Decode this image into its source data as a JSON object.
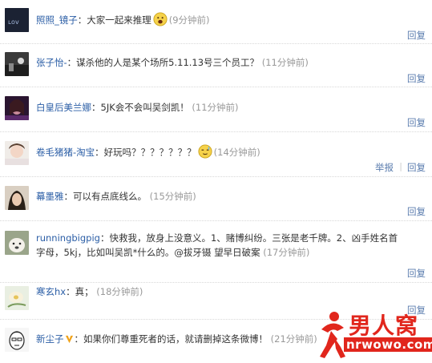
{
  "comments": [
    {
      "user": "照照_镜子",
      "text": "大家一起来推理",
      "time": "(9分钟前)",
      "reply": "回复",
      "emoji": "yawning-face-icon"
    },
    {
      "user": "张子怡-",
      "text": "谋杀他的人是某个场所5.11.13号三个员工？",
      "time": "(11分钟前)",
      "reply": "回复"
    },
    {
      "user": "白皇后美兰娜",
      "text": "5JK会不会叫吴剑凯！",
      "time": "(11分钟前)",
      "reply": "回复"
    },
    {
      "user": "卷毛猪猪-淘宝",
      "text": "好玩吗？？？？？？？",
      "time": "(14分钟前)",
      "report": "举报",
      "reply": "回复",
      "emoji": "sweating-face-icon"
    },
    {
      "user": "幕墨雅",
      "text": "可以有点底线么。",
      "time": "(15分钟前)",
      "reply": "回复"
    },
    {
      "user": "runningbigpig",
      "text": "快救我，放身上没意义。1、赌博纠纷。三张是老千牌。2、凶手姓名首字母，5kj，比如叫吴凯*什么的。@拔牙镊 望早日破案",
      "time": "(17分钟前)",
      "reply": "回复"
    },
    {
      "user": "寒玄hx",
      "text": "真；",
      "time": "(18分钟前)",
      "reply": "回复"
    },
    {
      "user": "新尘子",
      "text": "如果你们尊重死者的话，就请删掉这条微博！",
      "time": "(21分钟前)",
      "reply": "回复"
    }
  ],
  "separator": "：",
  "watermark": {
    "name": "男人窝",
    "url": "nrwowo.com"
  },
  "colors": {
    "user": "#2b5ea6",
    "time": "#999999",
    "link": "#5a7cae",
    "brand": "#e1261c"
  }
}
